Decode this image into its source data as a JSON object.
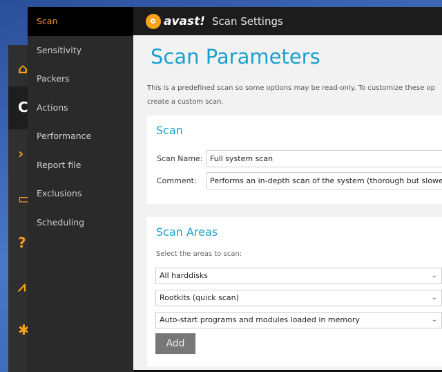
{
  "app": {
    "brand": "avast!",
    "title": "Scan Settings"
  },
  "rail": {
    "icons": [
      "home-icon",
      "scan-icon",
      "tools-icon",
      "monitor-icon",
      "help-icon",
      "stats-icon",
      "settings-icon"
    ],
    "accent": "#f7a21b"
  },
  "sidebar": {
    "items": [
      {
        "label": "Scan"
      },
      {
        "label": "Sensitivity"
      },
      {
        "label": "Packers"
      },
      {
        "label": "Actions"
      },
      {
        "label": "Performance"
      },
      {
        "label": "Report file"
      },
      {
        "label": "Exclusions"
      },
      {
        "label": "Scheduling"
      }
    ],
    "selected": "Scan"
  },
  "main": {
    "title": "Scan Parameters",
    "description_line1": "This is a predefined scan so some options may be read-only. To customize these op",
    "description_line2": "create a custom scan.",
    "scan": {
      "heading": "Scan",
      "name_label": "Scan Name:",
      "name_value": "Full system scan",
      "comment_label": "Comment:",
      "comment_value": "Performs an in-depth scan of the system (thorough but slower"
    },
    "areas": {
      "heading": "Scan Areas",
      "instruction": "Select the areas to scan:",
      "selects": [
        "All harddisks",
        "Rootkits (quick scan)",
        "Auto-start programs and modules loaded in memory"
      ],
      "add_label": "Add"
    }
  }
}
